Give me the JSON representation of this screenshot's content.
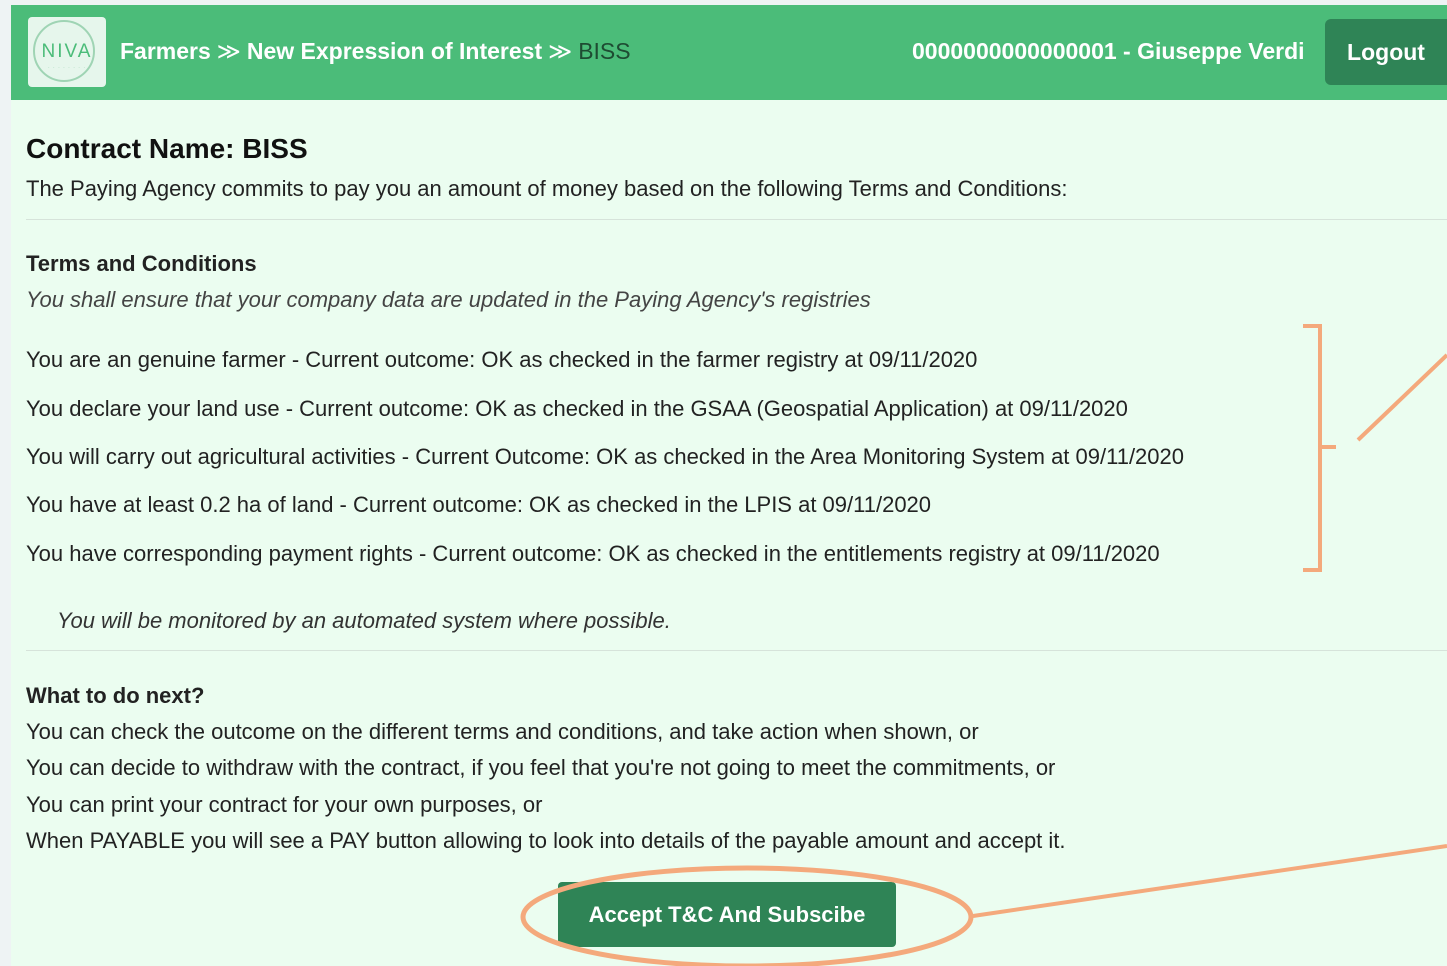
{
  "header": {
    "logo_text": "NIVA",
    "breadcrumb": [
      "Farmers",
      "New Expression of Interest",
      "BISS"
    ],
    "separator": "≫",
    "user": "0000000000000001 - Giuseppe Verdi",
    "logout_label": "Logout"
  },
  "contract": {
    "title": "Contract Name: BISS",
    "intro": "The Paying Agency commits to pay you an amount of money based on the following Terms and Conditions:"
  },
  "terms": {
    "heading": "Terms and Conditions",
    "note": "You shall ensure that your company data are updated in the Paying Agency's registries",
    "items": [
      "You are an genuine farmer - Current outcome: OK as checked in the farmer registry at 09/11/2020",
      "You declare your land use - Current outcome: OK as checked in the GSAA (Geospatial Application) at 09/11/2020",
      "You will carry out agricultural activities - Current Outcome: OK as checked in the Area Monitoring System at 09/11/2020",
      "You have at least 0.2 ha of land - Current outcome: OK as checked in the LPIS at 09/11/2020",
      "You have corresponding payment rights - Current outcome: OK as checked in the entitlements registry at 09/11/2020"
    ],
    "monitoring": "You will be monitored by an automated system where possible."
  },
  "next": {
    "heading": "What to do next?",
    "lines": [
      "You can check the outcome on the different terms and conditions, and take action when shown, or",
      "You can decide to withdraw with the contract, if you feel that you're not going to meet the commitments, or",
      "You can print your contract for your own purposes, or",
      "When PAYABLE you will see a PAY button allowing to look into details of the payable amount and accept it."
    ]
  },
  "accept_label": "Accept T&C And Subscibe",
  "colors": {
    "navbar": "#4bbc79",
    "button": "#2f8456",
    "page": "#ebfdf0",
    "annotation": "#f4a97c"
  }
}
